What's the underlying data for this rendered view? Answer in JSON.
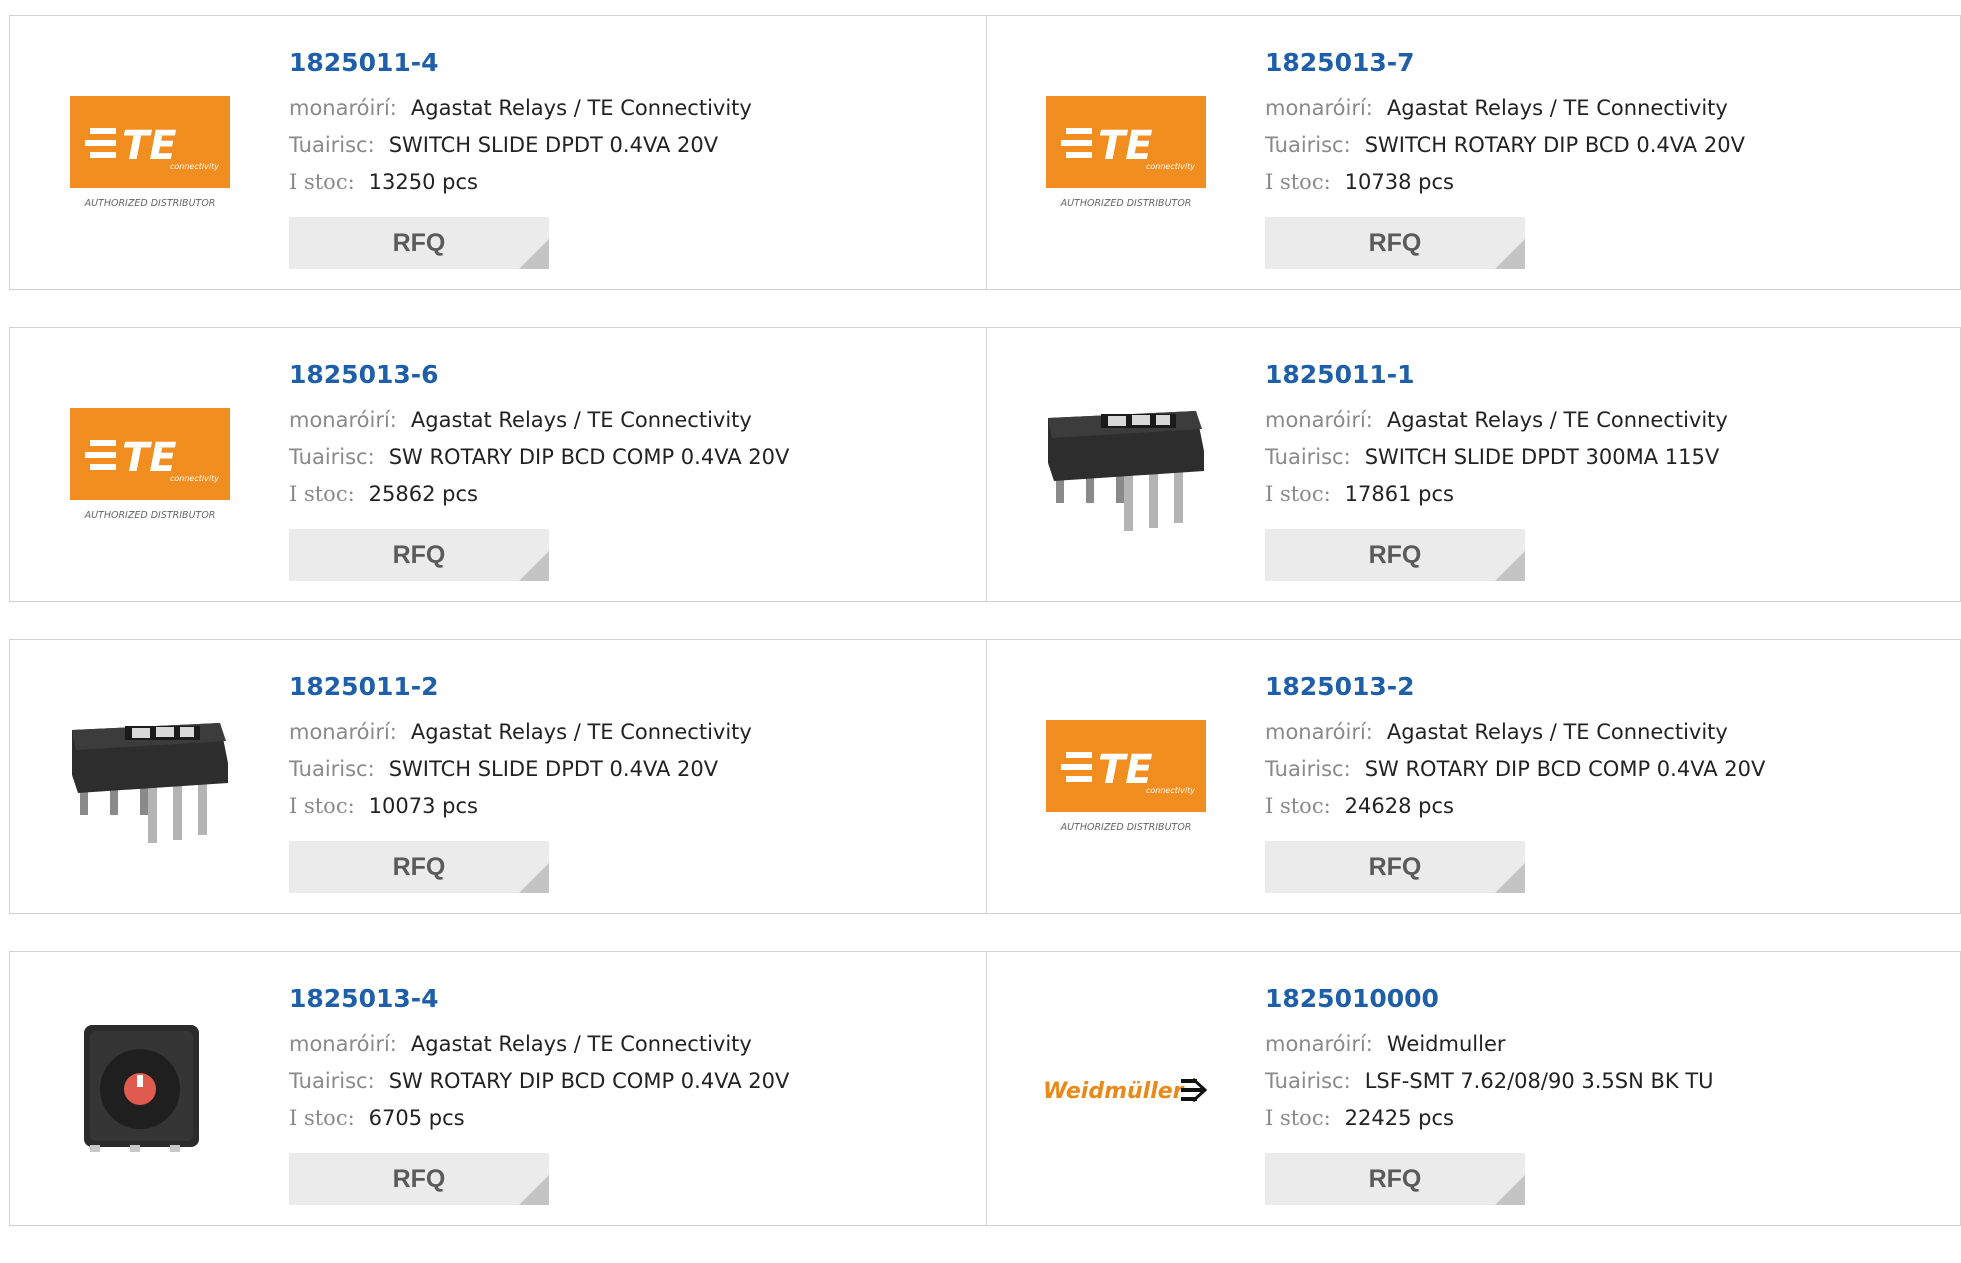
{
  "labels": {
    "manufacturer": "monaróirí:",
    "description": "Tuairisc:",
    "stock": "I stoc:",
    "rfq": "RFQ"
  },
  "brand": {
    "te_name": "TE",
    "te_sub": "connectivity",
    "te_tagline": "AUTHORIZED DISTRIBUTOR",
    "weid_name": "Weidmüller"
  },
  "colors": {
    "te_orange": "#f28d1f",
    "link_blue": "#1e5fa8"
  },
  "products": [
    {
      "part": "1825011-4",
      "manufacturer": "Agastat Relays / TE Connectivity",
      "description": "SWITCH SLIDE DPDT 0.4VA 20V",
      "stock": "13250 pcs",
      "image": "te-logo"
    },
    {
      "part": "1825013-7",
      "manufacturer": "Agastat Relays / TE Connectivity",
      "description": "SWITCH ROTARY DIP BCD 0.4VA 20V",
      "stock": "10738 pcs",
      "image": "te-logo"
    },
    {
      "part": "1825013-6",
      "manufacturer": "Agastat Relays / TE Connectivity",
      "description": "SW ROTARY DIP BCD COMP 0.4VA 20V",
      "stock": "25862 pcs",
      "image": "te-logo"
    },
    {
      "part": "1825011-1",
      "manufacturer": "Agastat Relays / TE Connectivity",
      "description": "SWITCH SLIDE DPDT 300MA 115V",
      "stock": "17861 pcs",
      "image": "dip-switch"
    },
    {
      "part": "1825011-2",
      "manufacturer": "Agastat Relays / TE Connectivity",
      "description": "SWITCH SLIDE DPDT 0.4VA 20V",
      "stock": "10073 pcs",
      "image": "dip-switch"
    },
    {
      "part": "1825013-2",
      "manufacturer": "Agastat Relays / TE Connectivity",
      "description": "SW ROTARY DIP BCD COMP 0.4VA 20V",
      "stock": "24628 pcs",
      "image": "te-logo"
    },
    {
      "part": "1825013-4",
      "manufacturer": "Agastat Relays / TE Connectivity",
      "description": "SW ROTARY DIP BCD COMP 0.4VA 20V",
      "stock": "6705 pcs",
      "image": "rotary-switch"
    },
    {
      "part": "1825010000",
      "manufacturer": "Weidmuller",
      "description": "LSF-SMT 7.62/08/90 3.5SN BK TU",
      "stock": "22425 pcs",
      "image": "weidmuller-logo"
    }
  ]
}
